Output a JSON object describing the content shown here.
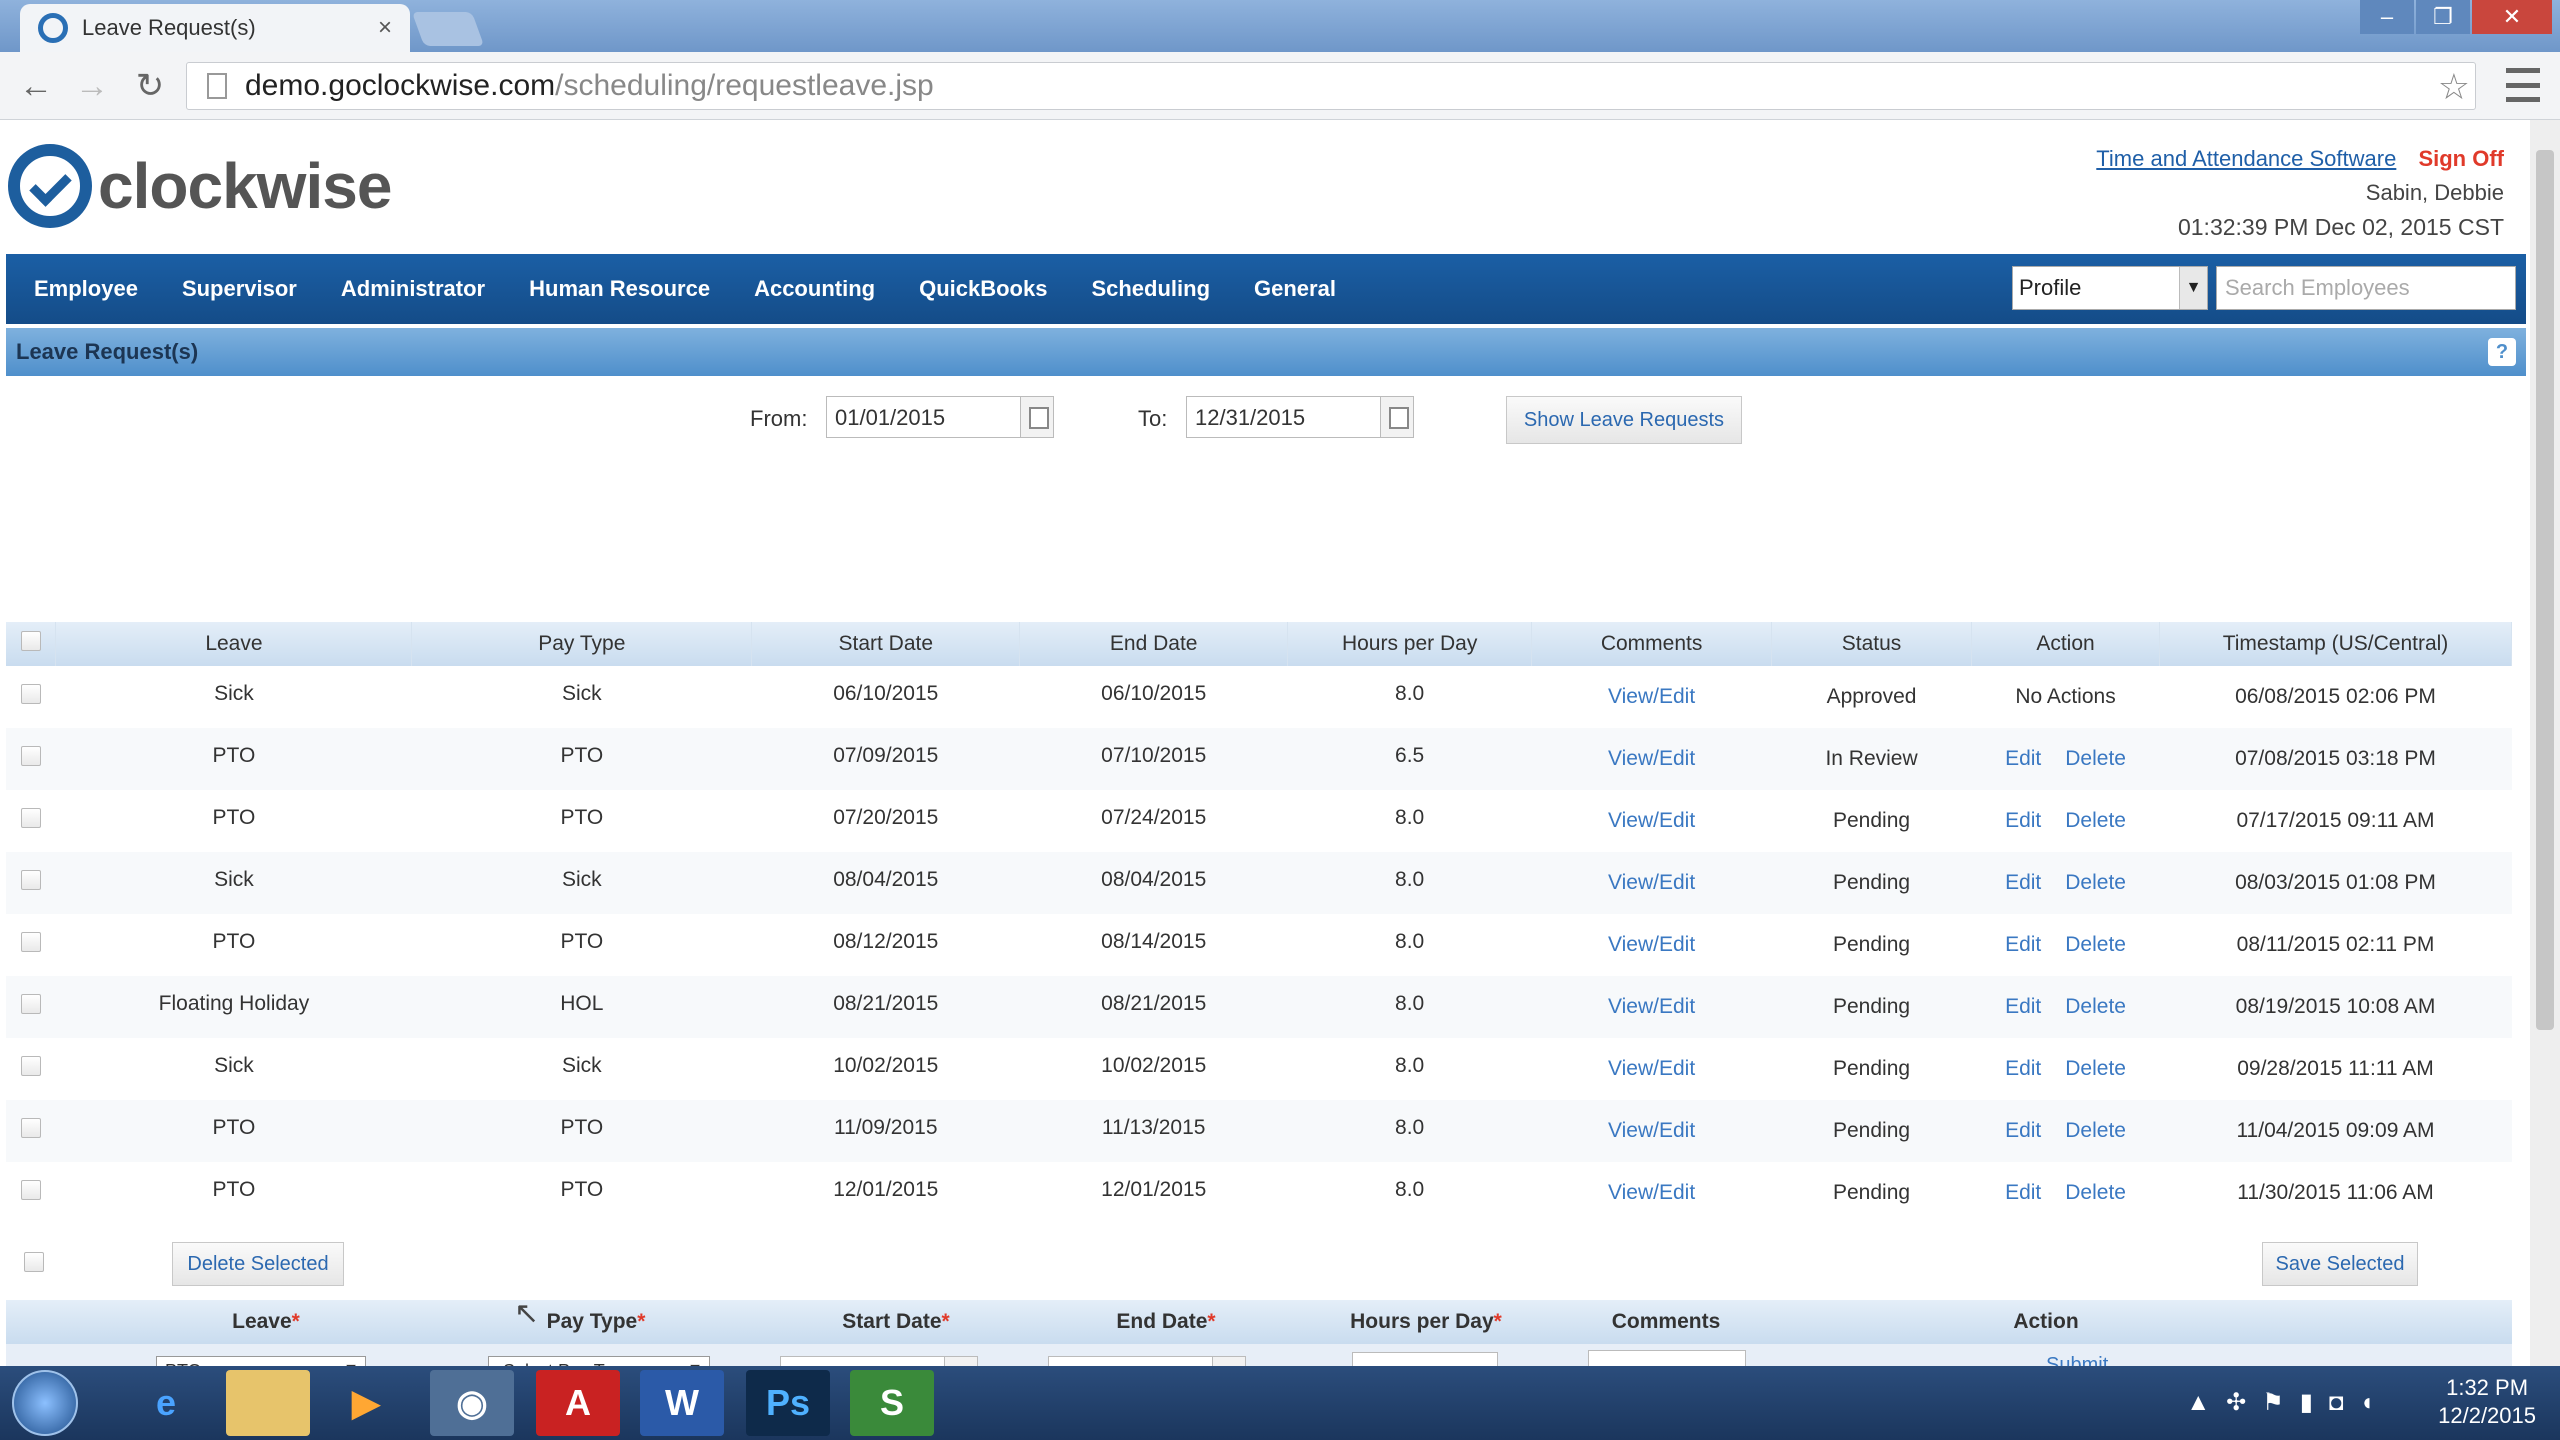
{
  "browser": {
    "tab_title": "Leave Request(s)",
    "url_host": "demo.goclockwise.com",
    "url_path": "/scheduling/requestleave.jsp"
  },
  "header": {
    "logo": "clockwise",
    "tas_link": "Time and Attendance Software",
    "sign_off": "Sign Off",
    "user": "Sabin, Debbie",
    "datetime": "01:32:39 PM Dec 02, 2015 CST"
  },
  "nav": {
    "items": [
      "Employee",
      "Supervisor",
      "Administrator",
      "Human Resource",
      "Accounting",
      "QuickBooks",
      "Scheduling",
      "General"
    ],
    "profile_select": "Profile",
    "search_placeholder": "Search Employees"
  },
  "section": {
    "title": "Leave Request(s)",
    "help": "?"
  },
  "filter": {
    "from_label": "From:",
    "from_value": "01/01/2015",
    "to_label": "To:",
    "to_value": "12/31/2015",
    "show_button": "Show Leave Requests"
  },
  "grid": {
    "columns": [
      "Leave",
      "Pay Type",
      "Start Date",
      "End Date",
      "Hours per Day",
      "Comments",
      "Status",
      "Action",
      "Timestamp (US/Central)"
    ],
    "rows": [
      {
        "leave": "Sick",
        "pay": "Sick",
        "start": "06/10/2015",
        "end": "06/10/2015",
        "hours": "8.0",
        "comments": "View/Edit",
        "status": "Approved",
        "action": "No Actions",
        "timestamp": "06/08/2015 02:06 PM"
      },
      {
        "leave": "PTO",
        "pay": "PTO",
        "start": "07/09/2015",
        "end": "07/10/2015",
        "hours": "6.5",
        "comments": "View/Edit",
        "status": "In Review",
        "action": "",
        "timestamp": "07/08/2015 03:18 PM"
      },
      {
        "leave": "PTO",
        "pay": "PTO",
        "start": "07/20/2015",
        "end": "07/24/2015",
        "hours": "8.0",
        "comments": "View/Edit",
        "status": "Pending",
        "action": "",
        "timestamp": "07/17/2015 09:11 AM"
      },
      {
        "leave": "Sick",
        "pay": "Sick",
        "start": "08/04/2015",
        "end": "08/04/2015",
        "hours": "8.0",
        "comments": "View/Edit",
        "status": "Pending",
        "action": "",
        "timestamp": "08/03/2015 01:08 PM"
      },
      {
        "leave": "PTO",
        "pay": "PTO",
        "start": "08/12/2015",
        "end": "08/14/2015",
        "hours": "8.0",
        "comments": "View/Edit",
        "status": "Pending",
        "action": "",
        "timestamp": "08/11/2015 02:11 PM"
      },
      {
        "leave": "Floating Holiday",
        "pay": "HOL",
        "start": "08/21/2015",
        "end": "08/21/2015",
        "hours": "8.0",
        "comments": "View/Edit",
        "status": "Pending",
        "action": "",
        "timestamp": "08/19/2015 10:08 AM"
      },
      {
        "leave": "Sick",
        "pay": "Sick",
        "start": "10/02/2015",
        "end": "10/02/2015",
        "hours": "8.0",
        "comments": "View/Edit",
        "status": "Pending",
        "action": "",
        "timestamp": "09/28/2015 11:11 AM"
      },
      {
        "leave": "PTO",
        "pay": "PTO",
        "start": "11/09/2015",
        "end": "11/13/2015",
        "hours": "8.0",
        "comments": "View/Edit",
        "status": "Pending",
        "action": "",
        "timestamp": "11/04/2015 09:09 AM"
      },
      {
        "leave": "PTO",
        "pay": "PTO",
        "start": "12/01/2015",
        "end": "12/01/2015",
        "hours": "8.0",
        "comments": "View/Edit",
        "status": "Pending",
        "action": "",
        "timestamp": "11/30/2015 11:06 AM"
      }
    ],
    "edit_label": "Edit",
    "delete_label": "Delete",
    "delete_selected": "Delete Selected",
    "save_selected": "Save Selected"
  },
  "add_form": {
    "columns": [
      "Leave",
      "Pay Type",
      "Start Date",
      "End Date",
      "Hours per Day",
      "Comments",
      "Action"
    ],
    "required_mark": "*",
    "leave_value": "PTO",
    "pay_type_value": "-Select Pay Type-",
    "submit": "Submit"
  },
  "taskbar": {
    "time": "1:32 PM",
    "date": "12/2/2015",
    "apps": [
      "ie-icon",
      "folder-icon",
      "media-icon",
      "chrome-icon",
      "acrobat-icon",
      "word-icon",
      "photoshop-icon",
      "snagit-icon"
    ]
  },
  "colors": {
    "nav_blue": "#1b5fa5",
    "section_blue": "#4f8fcb",
    "link": "#3a78c2",
    "signoff_red": "#e03a2a"
  }
}
